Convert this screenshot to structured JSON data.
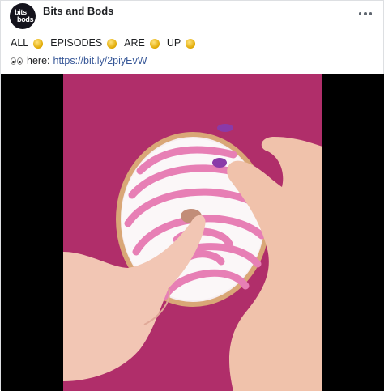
{
  "post": {
    "page_name": "Bits and Bods",
    "avatar_text_line1": "bits",
    "avatar_text_line2": "bods",
    "caption_line1_words": [
      "ALL",
      "EPISODES",
      "ARE",
      "UP"
    ],
    "caption_line2_prefix": "here:",
    "caption_link": "https://bit.ly/2piyEvW",
    "icons": {
      "more": "more-options-icon",
      "coin": "coin-emoji-icon",
      "eyes": "eyes-emoji-icon"
    }
  },
  "colors": {
    "link": "#385898",
    "video_background": "#b02e6a",
    "donut_stripe": "#e77fb5"
  }
}
